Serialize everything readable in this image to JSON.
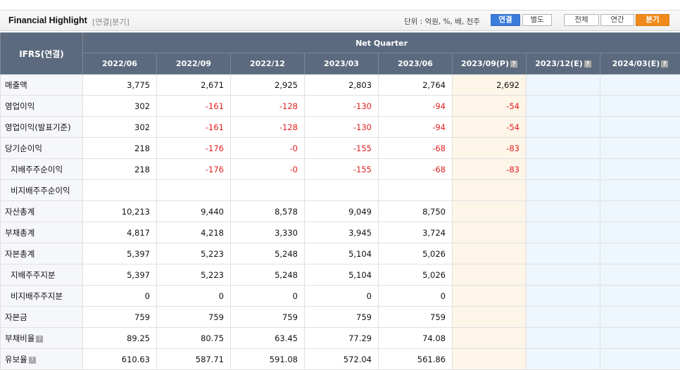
{
  "header": {
    "title": "Financial Highlight",
    "subtitle": "[연결|분기]",
    "unit_label": "단위 : 억원, %, 배, 천주",
    "buttons": {
      "consolidated": "연결",
      "separate": "별도",
      "all": "전체",
      "annual": "연간",
      "quarterly": "분기"
    }
  },
  "table": {
    "corner_label": "IFRS(연결)",
    "group_label": "Net Quarter",
    "periods": [
      "2022/06",
      "2022/09",
      "2022/12",
      "2023/03",
      "2023/06",
      "2023/09(P)",
      "2023/12(E)",
      "2024/03(E)"
    ],
    "help_icon": "?",
    "rows": [
      {
        "label": "매출액",
        "values": [
          "3,775",
          "2,671",
          "2,925",
          "2,803",
          "2,764",
          "2,692",
          "",
          ""
        ]
      },
      {
        "label": "영업이익",
        "values": [
          "302",
          "-161",
          "-128",
          "-130",
          "-94",
          "-54",
          "",
          ""
        ]
      },
      {
        "label": "영업이익(발표기준)",
        "values": [
          "302",
          "-161",
          "-128",
          "-130",
          "-94",
          "-54",
          "",
          ""
        ]
      },
      {
        "label": "당기순이익",
        "values": [
          "218",
          "-176",
          "-0",
          "-155",
          "-68",
          "-83",
          "",
          ""
        ]
      },
      {
        "label": "지배주주순이익",
        "values": [
          "218",
          "-176",
          "-0",
          "-155",
          "-68",
          "-83",
          "",
          ""
        ]
      },
      {
        "label": "비지배주주순이익",
        "values": [
          "",
          "",
          "",
          "",
          "",
          "",
          "",
          ""
        ]
      },
      {
        "label": "자산총계",
        "values": [
          "10,213",
          "9,440",
          "8,578",
          "9,049",
          "8,750",
          "",
          "",
          ""
        ]
      },
      {
        "label": "부채총계",
        "values": [
          "4,817",
          "4,218",
          "3,330",
          "3,945",
          "3,724",
          "",
          "",
          ""
        ]
      },
      {
        "label": "자본총계",
        "values": [
          "5,397",
          "5,223",
          "5,248",
          "5,104",
          "5,026",
          "",
          "",
          ""
        ]
      },
      {
        "label": "지배주주지분",
        "values": [
          "5,397",
          "5,223",
          "5,248",
          "5,104",
          "5,026",
          "",
          "",
          ""
        ]
      },
      {
        "label": "비지배주주지분",
        "values": [
          "0",
          "0",
          "0",
          "0",
          "0",
          "",
          "",
          ""
        ]
      },
      {
        "label": "자본금",
        "values": [
          "759",
          "759",
          "759",
          "759",
          "759",
          "",
          "",
          ""
        ]
      },
      {
        "label": "부채비율",
        "values": [
          "89.25",
          "80.75",
          "63.45",
          "77.29",
          "74.08",
          "",
          "",
          ""
        ]
      },
      {
        "label": "유보율",
        "values": [
          "610.63",
          "587.71",
          "591.08",
          "572.04",
          "561.86",
          "",
          "",
          ""
        ]
      }
    ]
  }
}
